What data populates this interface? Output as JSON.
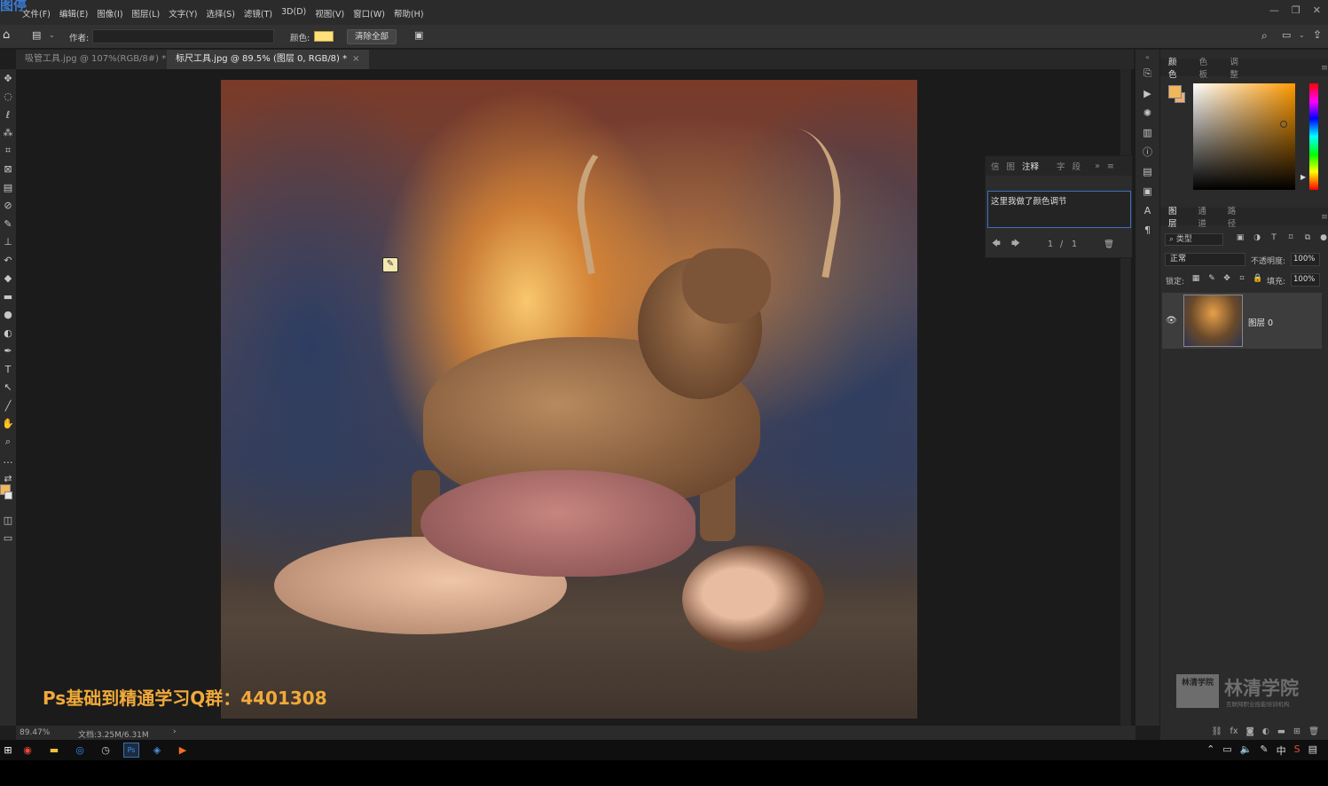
{
  "app": {
    "logo_text": "图停"
  },
  "menu": [
    "文件(F)",
    "编辑(E)",
    "图像(I)",
    "图层(L)",
    "文字(Y)",
    "选择(S)",
    "滤镜(T)",
    "3D(D)",
    "视图(V)",
    "窗口(W)",
    "帮助(H)"
  ],
  "window_controls": {
    "minimize": "—",
    "restore": "❐",
    "close": "✕"
  },
  "options": {
    "author_label": "作者:",
    "author_value": "",
    "color_label": "颜色:",
    "color_value": "#ffe07a",
    "clear_all": "清除全部"
  },
  "tabs": [
    {
      "label": "吸管工具.jpg @ 107%(RGB/8#) *",
      "close": "×"
    },
    {
      "label": "标尺工具.jpg @ 89.5% (图层 0, RGB/8) *",
      "close": "×"
    }
  ],
  "canvas": {
    "overlay_text": "Ps基础到精通学习Q群：4401308"
  },
  "notes_panel": {
    "tabs": [
      "信",
      "图",
      "注释",
      "字",
      "段"
    ],
    "active_tab": "注释",
    "note_text": "这里我做了颜色调节",
    "page_current": "1",
    "page_sep": "/",
    "page_total": "1"
  },
  "color_panel": {
    "tabs": [
      "颜色",
      "色板",
      "调整"
    ],
    "active_tab": "颜色",
    "foreground": "#f2b65b",
    "background": "#e9b079"
  },
  "layers_panel": {
    "tabs": [
      "图层",
      "通道",
      "路径"
    ],
    "active_tab": "图层",
    "search_placeholder": "类型",
    "blend_mode": "正常",
    "opacity_label": "不透明度:",
    "opacity_value": "100%",
    "lock_label": "锁定:",
    "fill_label": "填充:",
    "fill_value": "100%",
    "layers": [
      {
        "name": "图层 0",
        "visible": true
      }
    ]
  },
  "brand": {
    "box_text": "林清学院",
    "name": "林清学院",
    "sub": "互联网职业技能培训机构"
  },
  "status": {
    "zoom": "89.47%",
    "doc_size": "文档:3.25M/6.31M",
    "arrow": "›"
  },
  "tray": {
    "ime": "中"
  }
}
